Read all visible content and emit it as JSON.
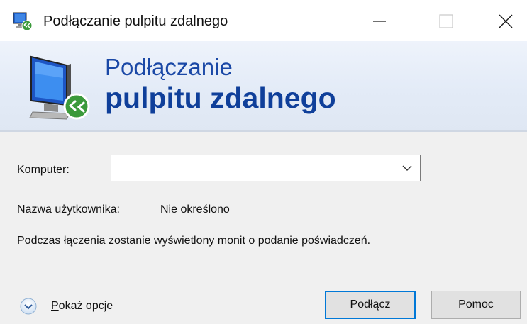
{
  "window": {
    "title": "Podłączanie pulpitu zdalnego",
    "icon": "remote-desktop-icon"
  },
  "caption_buttons": {
    "minimize_icon": "minimize-icon",
    "maximize_icon": "maximize-icon",
    "close_icon": "close-icon"
  },
  "banner": {
    "line1": "Podłączanie",
    "line2": "pulpitu zdalnego",
    "icon": "remote-desktop-monitor-icon",
    "accent_color": "#1a48a6"
  },
  "form": {
    "computer_label": "Komputer:",
    "computer_value": "",
    "computer_placeholder": "",
    "user_label": "Nazwa użytkownika:",
    "user_value": "Nie określono",
    "info": "Podczas łączenia zostanie wyświetlony monit o podanie poświadczeń."
  },
  "footer": {
    "options_label_underlined": "P",
    "options_label_rest": "okaż opcje",
    "connect_label": "Podłącz",
    "help_label": "Pomoc",
    "focus_color": "#0078d7"
  }
}
